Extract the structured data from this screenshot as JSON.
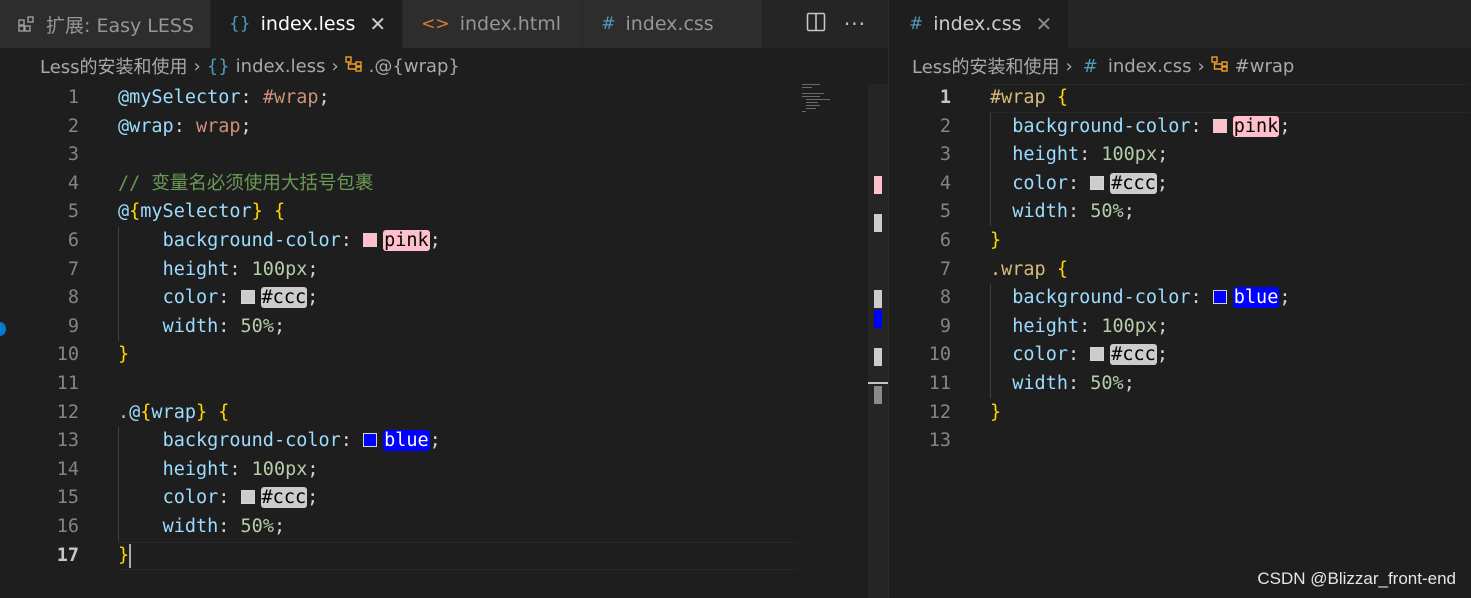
{
  "left": {
    "tabs": [
      {
        "icon": "extension-icon",
        "label": "扩展: Easy LESS",
        "active": false
      },
      {
        "icon": "less-braces-icon",
        "label": "index.less",
        "active": true
      },
      {
        "icon": "html-icon",
        "label": "index.html",
        "active": false
      },
      {
        "icon": "css-hash-icon",
        "label": "index.css",
        "active": false
      }
    ],
    "breadcrumb": [
      "Less的安装和使用",
      "index.less",
      ".@{wrap}"
    ],
    "lines": [
      {
        "n": "1",
        "code": [
          [
            "t-var",
            "@mySelector"
          ],
          [
            "t-plain",
            ": "
          ],
          [
            "t-str",
            "#wrap"
          ],
          [
            "t-plain",
            ";"
          ]
        ]
      },
      {
        "n": "2",
        "code": [
          [
            "t-var",
            "@wrap"
          ],
          [
            "t-plain",
            ": "
          ],
          [
            "t-str",
            "wrap"
          ],
          [
            "t-plain",
            ";"
          ]
        ]
      },
      {
        "n": "3",
        "code": []
      },
      {
        "n": "4",
        "code": [
          [
            "t-com",
            "// 变量名必须使用大括号包裹"
          ]
        ]
      },
      {
        "n": "5",
        "code": [
          [
            "t-var",
            "@"
          ],
          [
            "t-brk",
            "{"
          ],
          [
            "t-var",
            "mySelector"
          ],
          [
            "t-brk",
            "}"
          ],
          [
            "t-plain",
            " "
          ],
          [
            "t-brk",
            "{"
          ]
        ]
      },
      {
        "n": "6",
        "code": [
          [
            "t-plain",
            "    "
          ],
          [
            "t-prop",
            "background-color"
          ],
          [
            "t-plain",
            ": "
          ],
          [
            "sw",
            "pink"
          ],
          [
            "t-plain",
            ";"
          ]
        ]
      },
      {
        "n": "7",
        "code": [
          [
            "t-plain",
            "    "
          ],
          [
            "t-prop",
            "height"
          ],
          [
            "t-plain",
            ": "
          ],
          [
            "t-num",
            "100px"
          ],
          [
            "t-plain",
            ";"
          ]
        ]
      },
      {
        "n": "8",
        "code": [
          [
            "t-plain",
            "    "
          ],
          [
            "t-prop",
            "color"
          ],
          [
            "t-plain",
            ": "
          ],
          [
            "sw",
            "#ccc"
          ],
          [
            "t-plain",
            ";"
          ]
        ]
      },
      {
        "n": "9",
        "code": [
          [
            "t-plain",
            "    "
          ],
          [
            "t-prop",
            "width"
          ],
          [
            "t-plain",
            ": "
          ],
          [
            "t-num",
            "50%"
          ],
          [
            "t-plain",
            ";"
          ]
        ]
      },
      {
        "n": "10",
        "code": [
          [
            "t-brk",
            "}"
          ]
        ]
      },
      {
        "n": "11",
        "code": []
      },
      {
        "n": "12",
        "code": [
          [
            "t-sel",
            "."
          ],
          [
            "t-var",
            "@"
          ],
          [
            "t-brk",
            "{"
          ],
          [
            "t-var",
            "wrap"
          ],
          [
            "t-brk",
            "}"
          ],
          [
            "t-plain",
            " "
          ],
          [
            "t-brk",
            "{"
          ]
        ]
      },
      {
        "n": "13",
        "code": [
          [
            "t-plain",
            "    "
          ],
          [
            "t-prop",
            "background-color"
          ],
          [
            "t-plain",
            ": "
          ],
          [
            "sw",
            "blue"
          ],
          [
            "t-plain",
            ";"
          ]
        ]
      },
      {
        "n": "14",
        "code": [
          [
            "t-plain",
            "    "
          ],
          [
            "t-prop",
            "height"
          ],
          [
            "t-plain",
            ": "
          ],
          [
            "t-num",
            "100px"
          ],
          [
            "t-plain",
            ";"
          ]
        ]
      },
      {
        "n": "15",
        "code": [
          [
            "t-plain",
            "    "
          ],
          [
            "t-prop",
            "color"
          ],
          [
            "t-plain",
            ": "
          ],
          [
            "sw",
            "#ccc"
          ],
          [
            "t-plain",
            ";"
          ]
        ]
      },
      {
        "n": "16",
        "code": [
          [
            "t-plain",
            "    "
          ],
          [
            "t-prop",
            "width"
          ],
          [
            "t-plain",
            ": "
          ],
          [
            "t-num",
            "50%"
          ],
          [
            "t-plain",
            ";"
          ]
        ]
      },
      {
        "n": "17",
        "code": [
          [
            "t-brk",
            "}"
          ]
        ]
      }
    ],
    "current_line": "17"
  },
  "right": {
    "tabs": [
      {
        "icon": "css-hash-icon",
        "label": "index.css",
        "active": true
      }
    ],
    "breadcrumb": [
      "Less的安装和使用",
      "index.css",
      "#wrap"
    ],
    "lines": [
      {
        "n": "1",
        "code": [
          [
            "t-sel",
            "#wrap"
          ],
          [
            "t-plain",
            " "
          ],
          [
            "t-brk",
            "{"
          ]
        ]
      },
      {
        "n": "2",
        "code": [
          [
            "t-plain",
            "  "
          ],
          [
            "t-prop",
            "background-color"
          ],
          [
            "t-plain",
            ": "
          ],
          [
            "sw",
            "pink"
          ],
          [
            "t-plain",
            ";"
          ]
        ]
      },
      {
        "n": "3",
        "code": [
          [
            "t-plain",
            "  "
          ],
          [
            "t-prop",
            "height"
          ],
          [
            "t-plain",
            ": "
          ],
          [
            "t-num",
            "100px"
          ],
          [
            "t-plain",
            ";"
          ]
        ]
      },
      {
        "n": "4",
        "code": [
          [
            "t-plain",
            "  "
          ],
          [
            "t-prop",
            "color"
          ],
          [
            "t-plain",
            ": "
          ],
          [
            "sw",
            "#ccc"
          ],
          [
            "t-plain",
            ";"
          ]
        ]
      },
      {
        "n": "5",
        "code": [
          [
            "t-plain",
            "  "
          ],
          [
            "t-prop",
            "width"
          ],
          [
            "t-plain",
            ": "
          ],
          [
            "t-num",
            "50%"
          ],
          [
            "t-plain",
            ";"
          ]
        ]
      },
      {
        "n": "6",
        "code": [
          [
            "t-brk",
            "}"
          ]
        ]
      },
      {
        "n": "7",
        "code": [
          [
            "t-sel",
            ".wrap"
          ],
          [
            "t-plain",
            " "
          ],
          [
            "t-brk",
            "{"
          ]
        ]
      },
      {
        "n": "8",
        "code": [
          [
            "t-plain",
            "  "
          ],
          [
            "t-prop",
            "background-color"
          ],
          [
            "t-plain",
            ": "
          ],
          [
            "sw",
            "blue"
          ],
          [
            "t-plain",
            ";"
          ]
        ]
      },
      {
        "n": "9",
        "code": [
          [
            "t-plain",
            "  "
          ],
          [
            "t-prop",
            "height"
          ],
          [
            "t-plain",
            ": "
          ],
          [
            "t-num",
            "100px"
          ],
          [
            "t-plain",
            ";"
          ]
        ]
      },
      {
        "n": "10",
        "code": [
          [
            "t-plain",
            "  "
          ],
          [
            "t-prop",
            "color"
          ],
          [
            "t-plain",
            ": "
          ],
          [
            "sw",
            "#ccc"
          ],
          [
            "t-plain",
            ";"
          ]
        ]
      },
      {
        "n": "11",
        "code": [
          [
            "t-plain",
            "  "
          ],
          [
            "t-prop",
            "width"
          ],
          [
            "t-plain",
            ": "
          ],
          [
            "t-num",
            "50%"
          ],
          [
            "t-plain",
            ";"
          ]
        ]
      },
      {
        "n": "12",
        "code": [
          [
            "t-brk",
            "}"
          ]
        ]
      },
      {
        "n": "13",
        "code": []
      }
    ],
    "current_line": "1"
  },
  "swatch_colors": {
    "pink": {
      "bg": "#ffc0cb",
      "fg": "#000000"
    },
    "#ccc": {
      "bg": "#cccccc",
      "fg": "#000000"
    },
    "blue": {
      "bg": "#0000ff",
      "fg": "#ffffff"
    }
  },
  "watermark": "CSDN @Blizzar_front-end",
  "colors": {
    "editor_bg": "#1e1e1e",
    "tabbar_bg": "#252526",
    "accent": "#007acc"
  }
}
